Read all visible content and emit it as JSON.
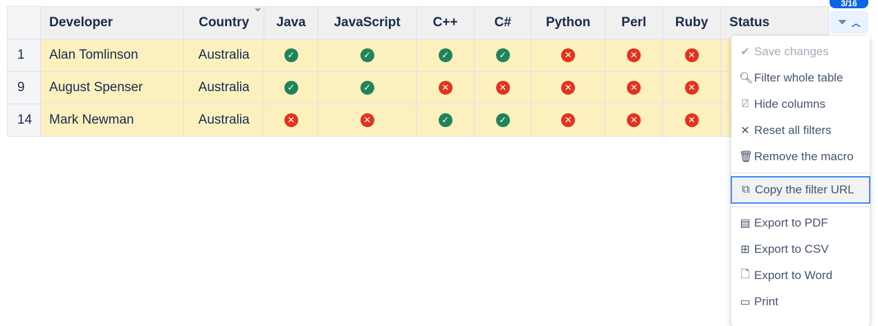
{
  "table": {
    "headers": [
      "",
      "Developer",
      "Country",
      "Java",
      "JavaScript",
      "C++",
      "C#",
      "Python",
      "Perl",
      "Ruby",
      "Status"
    ],
    "rows": [
      {
        "num": "1",
        "developer": "Alan Tomlinson",
        "country": "Australia",
        "langs": [
          true,
          true,
          true,
          true,
          false,
          false,
          false
        ]
      },
      {
        "num": "9",
        "developer": "August Spenser",
        "country": "Australia",
        "langs": [
          true,
          true,
          false,
          false,
          false,
          false,
          false
        ]
      },
      {
        "num": "14",
        "developer": "Mark Newman",
        "country": "Australia",
        "langs": [
          false,
          false,
          true,
          true,
          false,
          false,
          false
        ]
      }
    ]
  },
  "filter": {
    "badge": "3/16"
  },
  "menu": {
    "items": [
      {
        "label": "Save changes",
        "icon": "check-icon"
      },
      {
        "label": "Filter whole table",
        "icon": "search-icon"
      },
      {
        "label": "Hide columns",
        "icon": "hide-columns-icon"
      },
      {
        "label": "Reset all filters",
        "icon": "close-icon"
      },
      {
        "label": "Remove the macro",
        "icon": "trash-icon"
      },
      {
        "label": "Copy the filter URL",
        "icon": "copy-icon"
      },
      {
        "label": "Export to PDF",
        "icon": "pdf-icon"
      },
      {
        "label": "Export to CSV",
        "icon": "csv-icon"
      },
      {
        "label": "Export to Word",
        "icon": "word-icon"
      },
      {
        "label": "Print",
        "icon": "print-icon"
      }
    ]
  },
  "colors": {
    "ok": "#1f845a",
    "no": "#e2341d",
    "accent": "#0c66e4"
  }
}
